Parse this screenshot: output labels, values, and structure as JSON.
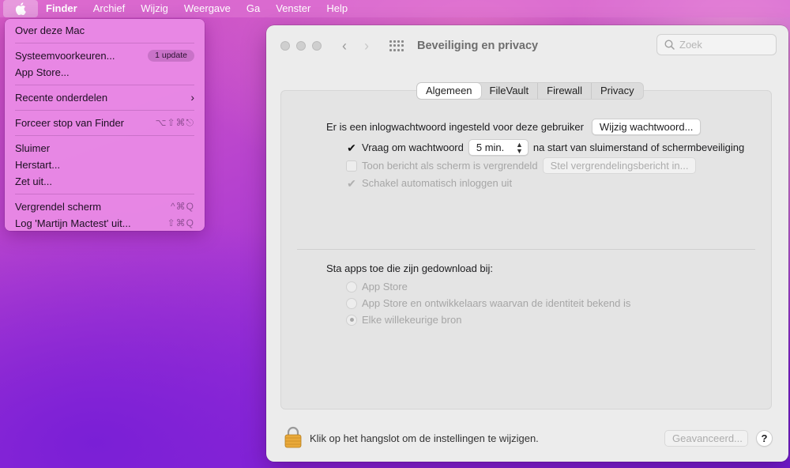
{
  "menubar": {
    "apple_icon": "apple-icon",
    "items": [
      "Finder",
      "Archief",
      "Wijzig",
      "Weergave",
      "Ga",
      "Venster",
      "Help"
    ]
  },
  "apple_menu": {
    "about": "Over deze Mac",
    "system_prefs": "Systeemvoorkeuren...",
    "update_badge": "1 update",
    "app_store": "App Store...",
    "recent_items": "Recente onderdelen",
    "force_quit": "Forceer stop van Finder",
    "force_quit_shortcut": "⌥⇧⌘⎋",
    "sleep": "Sluimer",
    "restart": "Herstart...",
    "shutdown": "Zet uit...",
    "lock_screen": "Vergrendel scherm",
    "lock_screen_shortcut": "^⌘Q",
    "logout": "Log 'Martijn Mactest' uit...",
    "logout_shortcut": "⇧⌘Q"
  },
  "window": {
    "title": "Beveiliging en privacy",
    "search_placeholder": "Zoek",
    "tabs": [
      "Algemeen",
      "FileVault",
      "Firewall",
      "Privacy"
    ],
    "active_tab": "Algemeen",
    "general": {
      "password_set_label": "Er is een inlogwachtwoord ingesteld voor deze gebruiker",
      "change_password_button": "Wijzig wachtwoord...",
      "require_password_label": "Vraag om wachtwoord",
      "require_password_checked": true,
      "require_password_delay": "5 min.",
      "require_password_suffix": "na start van sluimerstand of schermbeveiliging",
      "show_message_label": "Toon bericht als scherm is vergrendeld",
      "show_message_checked": false,
      "set_message_button": "Stel vergrendelingsbericht in...",
      "disable_autologin_label": "Schakel automatisch inloggen uit",
      "disable_autologin_checked": true,
      "allow_apps_label": "Sta apps toe die zijn gedownload bij:",
      "allow_options": [
        "App Store",
        "App Store en ontwikkelaars waarvan de identiteit bekend is",
        "Elke willekeurige bron"
      ],
      "allow_selected": "Elke willekeurige bron"
    },
    "footer": {
      "lock_text": "Klik op het hangslot om de instellingen te wijzigen.",
      "advanced_button": "Geavanceerd...",
      "help_button": "?"
    }
  },
  "colors": {
    "menu_background": "#ea8ce6",
    "window_background": "#ececec",
    "lock_icon": "#e9a93a"
  }
}
